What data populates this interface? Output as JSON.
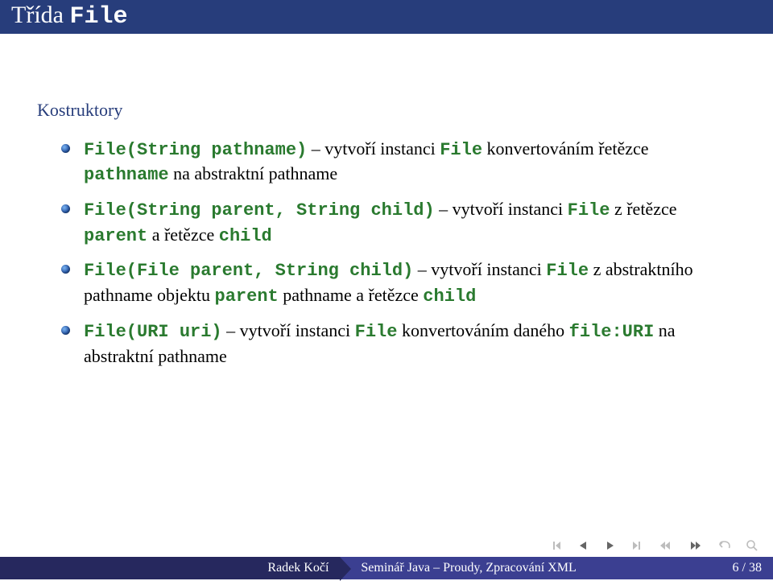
{
  "title": {
    "prefix": "Třída ",
    "mono": "File"
  },
  "subhead": "Kostruktory",
  "items": [
    {
      "parts": [
        {
          "t": "kw",
          "v": "File(String pathname)"
        },
        {
          "t": "txt",
          "v": " – vytvoří instanci "
        },
        {
          "t": "kw",
          "v": "File"
        },
        {
          "t": "txt",
          "v": " konvertováním řetězce "
        },
        {
          "t": "kw",
          "v": "pathname"
        },
        {
          "t": "txt",
          "v": " na abstraktní pathname"
        }
      ]
    },
    {
      "parts": [
        {
          "t": "kw",
          "v": "File(String parent, String child)"
        },
        {
          "t": "txt",
          "v": " – vytvoří instanci "
        },
        {
          "t": "kw",
          "v": "File"
        },
        {
          "t": "txt",
          "v": " z řetězce "
        },
        {
          "t": "kw",
          "v": "parent"
        },
        {
          "t": "txt",
          "v": " a řetězce "
        },
        {
          "t": "kw",
          "v": "child"
        }
      ]
    },
    {
      "parts": [
        {
          "t": "kw",
          "v": "File(File parent, String child)"
        },
        {
          "t": "txt",
          "v": " – vytvoří instanci "
        },
        {
          "t": "kw",
          "v": "File"
        },
        {
          "t": "txt",
          "v": " z abstraktního pathname objektu "
        },
        {
          "t": "kw",
          "v": "parent"
        },
        {
          "t": "txt",
          "v": " pathname a řetězce "
        },
        {
          "t": "kw",
          "v": "child"
        }
      ]
    },
    {
      "parts": [
        {
          "t": "kw",
          "v": "File(URI uri)"
        },
        {
          "t": "txt",
          "v": " – vytvoří instanci "
        },
        {
          "t": "kw",
          "v": "File"
        },
        {
          "t": "txt",
          "v": " konvertováním daného "
        },
        {
          "t": "kw",
          "v": "file:URI"
        },
        {
          "t": "txt",
          "v": " na abstraktní pathname"
        }
      ]
    }
  ],
  "footer": {
    "author": "Radek Kočí",
    "talk": "Seminář Java – Proudy, Zpracování XML",
    "page": "6 / 38"
  }
}
